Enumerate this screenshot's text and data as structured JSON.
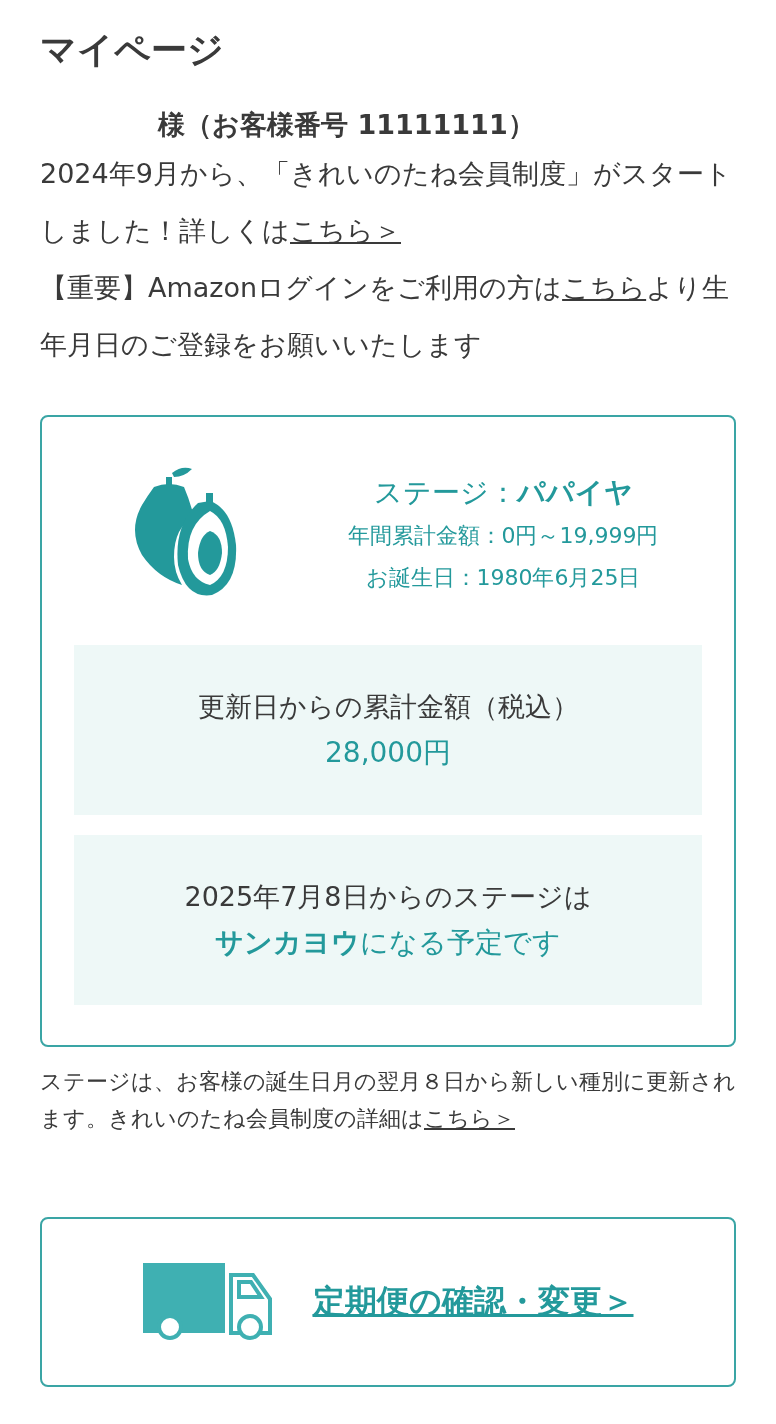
{
  "page_title": "マイページ",
  "customer_line": "様（お客様番号 11111111）",
  "notices": [
    {
      "text": "2024年9月から、「きれいのたね会員制度」がスタートしました！詳しくは",
      "link": "こちら＞"
    },
    {
      "text": "【重要】Amazonログインをご利用の方は",
      "link": "こちら",
      "after": "より生年月日のご登録をお願いいたします"
    }
  ],
  "stage_card": {
    "stage": "ステージ：**パパイヤ**",
    "annual_range": "年間累計金額：0円～19,999円",
    "birthday": "お誕生日：1980年6月25日",
    "cumulative": {
      "label": "更新日からの累計金額（税込）",
      "amount": "28,000円"
    },
    "next_stage": {
      "line_1": "2025年7月8日からのステージは",
      "line_2": "**サンカヨウ**になる予定です"
    }
  },
  "stage_note": {
    "text": "ステージは、お客様の誕生日月の翌月８日から新しい種別に更新されます。きれいのたね会員制度の詳細は",
    "link": "こちら＞"
  },
  "subscription_link": "定期便の確認・変更＞"
}
